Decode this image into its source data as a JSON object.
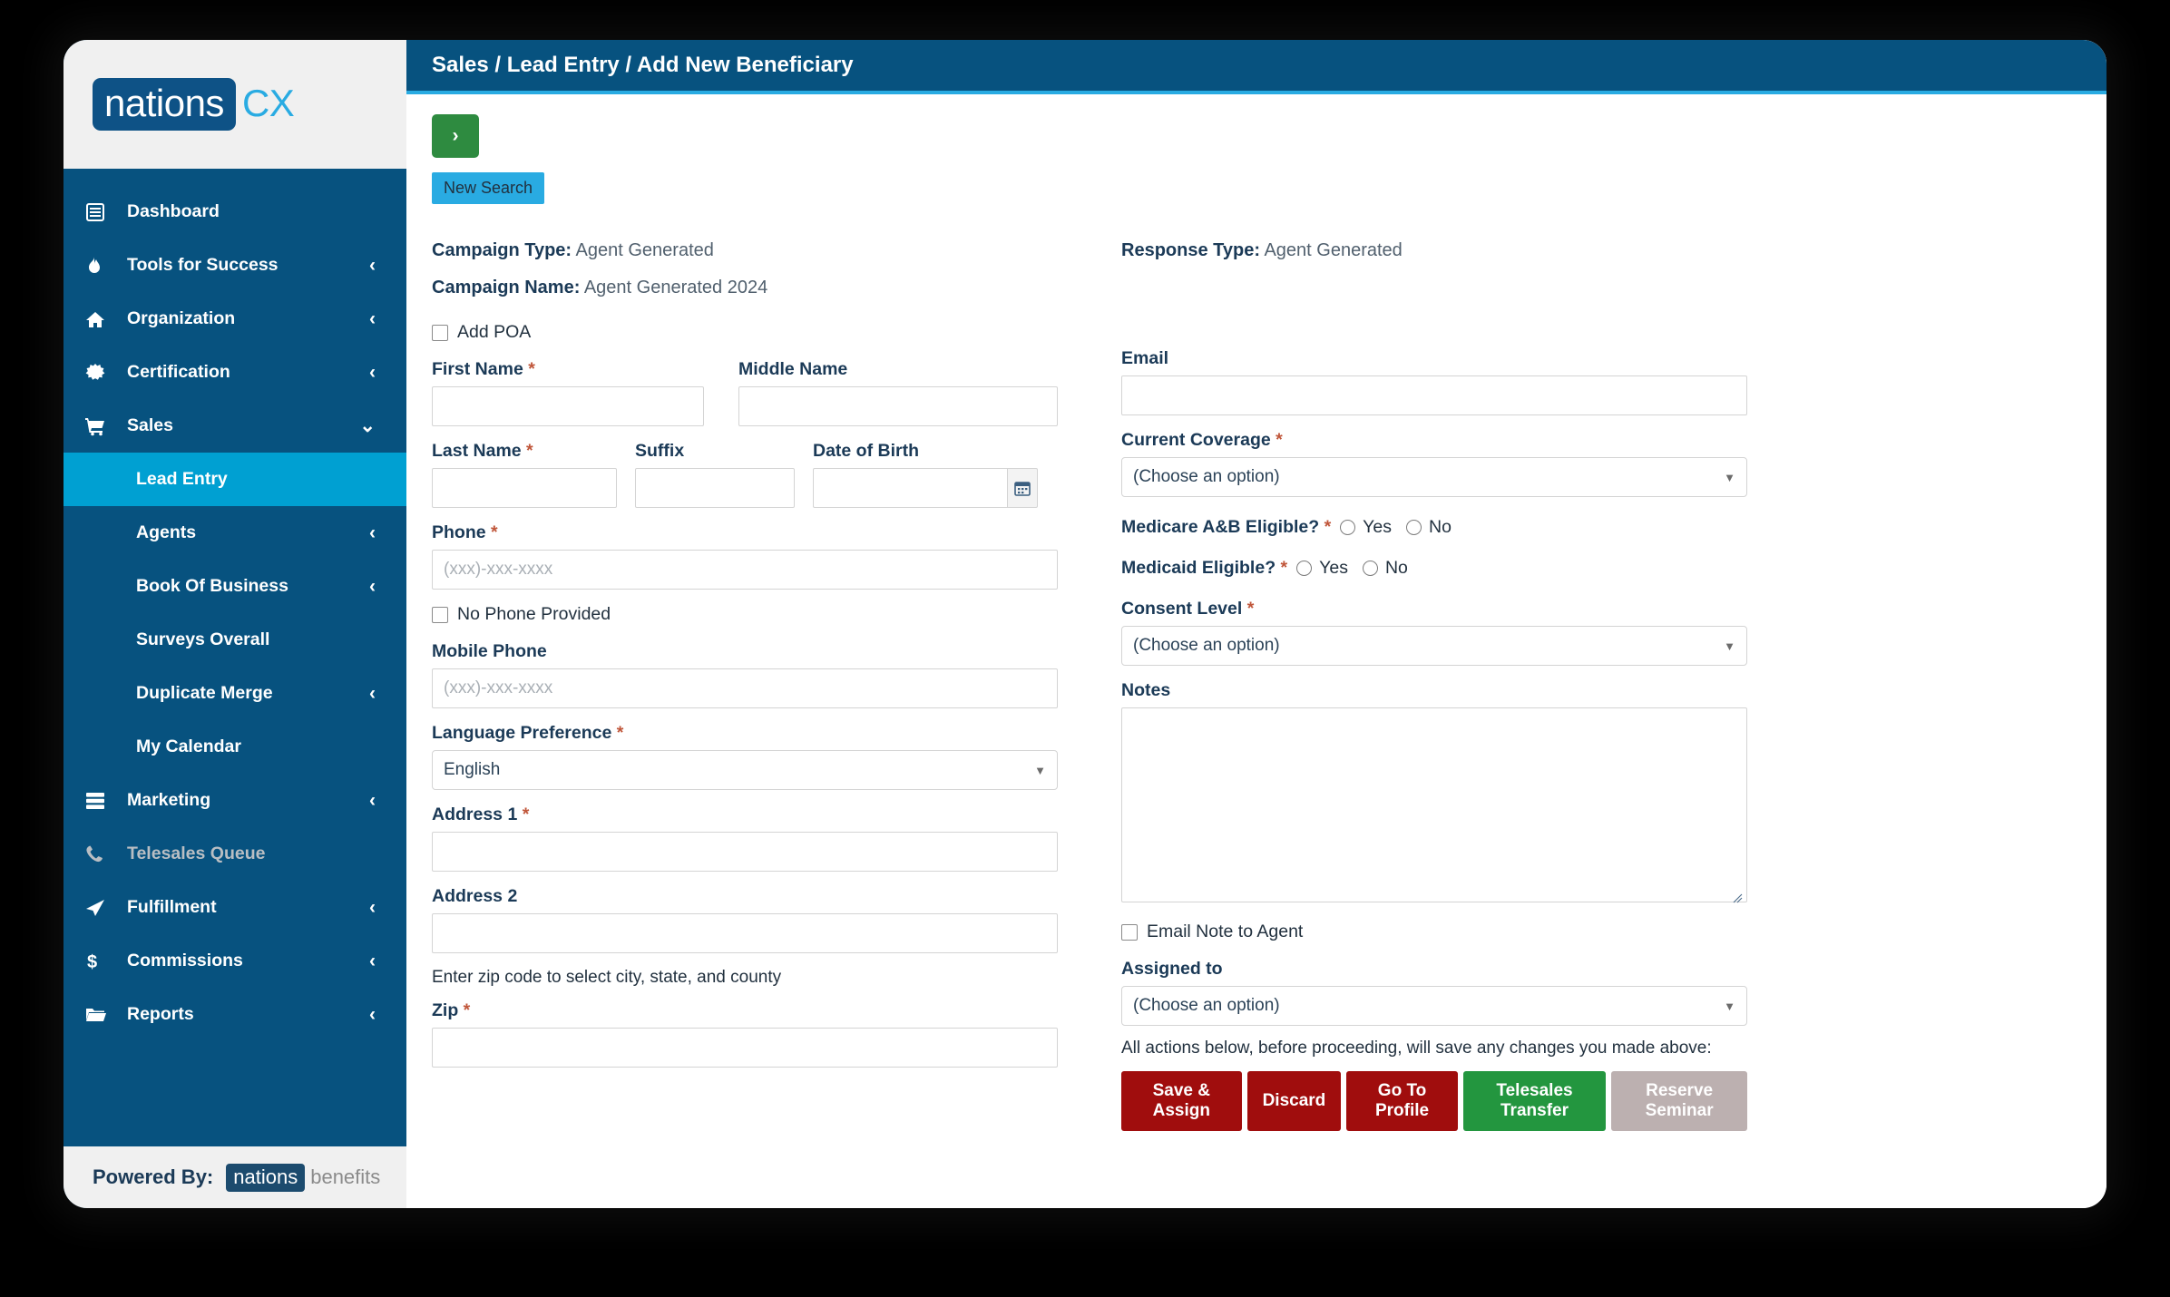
{
  "sidebar": {
    "logo": {
      "part1": "nations",
      "part2": "CX"
    },
    "items": [
      {
        "label": "Dashboard",
        "icon": "list-icon",
        "chevron": ""
      },
      {
        "label": "Tools for Success",
        "icon": "fire-icon",
        "chevron": "‹"
      },
      {
        "label": "Organization",
        "icon": "home-icon",
        "chevron": "‹"
      },
      {
        "label": "Certification",
        "icon": "certificate-icon",
        "chevron": "‹"
      },
      {
        "label": "Sales",
        "icon": "cart-icon",
        "chevron": "⌄"
      }
    ],
    "sub_items": [
      {
        "label": "Lead Entry",
        "chevron": "",
        "active": true
      },
      {
        "label": "Agents",
        "chevron": "‹",
        "active": false
      },
      {
        "label": "Book Of Business",
        "chevron": "‹",
        "active": false
      },
      {
        "label": "Surveys Overall",
        "chevron": "",
        "active": false
      },
      {
        "label": "Duplicate Merge",
        "chevron": "‹",
        "active": false
      },
      {
        "label": "My Calendar",
        "chevron": "",
        "active": false
      }
    ],
    "items_after": [
      {
        "label": "Marketing",
        "icon": "stack-icon",
        "chevron": "‹",
        "muted": false
      },
      {
        "label": "Telesales Queue",
        "icon": "phone-icon",
        "chevron": "",
        "muted": true
      },
      {
        "label": "Fulfillment",
        "icon": "send-icon",
        "chevron": "‹",
        "muted": false
      },
      {
        "label": "Commissions",
        "icon": "dollar-icon",
        "chevron": "‹",
        "muted": false
      },
      {
        "label": "Reports",
        "icon": "folder-icon",
        "chevron": "‹",
        "muted": false
      }
    ],
    "powered_by": {
      "label": "Powered By:",
      "brand1": "nations",
      "brand2": "benefits"
    }
  },
  "header": {
    "breadcrumb": "Sales / Lead Entry / Add New Beneficiary"
  },
  "toolbar": {
    "next_label": "›",
    "new_search_label": "New Search"
  },
  "meta": {
    "campaign_type_label": "Campaign Type:",
    "campaign_type_value": "Agent Generated",
    "campaign_name_label": "Campaign Name:",
    "campaign_name_value": "Agent Generated 2024",
    "response_type_label": "Response Type:",
    "response_type_value": "Agent Generated"
  },
  "form_left": {
    "add_poa_label": "Add POA",
    "first_name_label": "First Name",
    "first_name_value": "",
    "middle_name_label": "Middle Name",
    "middle_name_value": "",
    "last_name_label": "Last Name",
    "last_name_value": "",
    "suffix_label": "Suffix",
    "suffix_value": "",
    "dob_label": "Date of Birth",
    "dob_value": "",
    "phone_label": "Phone",
    "phone_placeholder": "(xxx)-xxx-xxxx",
    "phone_value": "",
    "no_phone_label": "No Phone Provided",
    "mobile_label": "Mobile Phone",
    "mobile_placeholder": "(xxx)-xxx-xxxx",
    "mobile_value": "",
    "language_label": "Language Preference",
    "language_value": "English",
    "address1_label": "Address 1",
    "address1_value": "",
    "address2_label": "Address 2",
    "address2_value": "",
    "zip_hint": "Enter zip code to select city, state, and county",
    "zip_label": "Zip",
    "zip_value": ""
  },
  "form_right": {
    "email_label": "Email",
    "email_value": "",
    "coverage_label": "Current Coverage",
    "coverage_value": "(Choose an option)",
    "medicare_label": "Medicare A&B Eligible?",
    "medicare_yes": "Yes",
    "medicare_no": "No",
    "medicaid_label": "Medicaid Eligible?",
    "medicaid_yes": "Yes",
    "medicaid_no": "No",
    "consent_label": "Consent Level",
    "consent_value": "(Choose an option)",
    "notes_label": "Notes",
    "notes_value": "",
    "email_note_label": "Email Note to Agent",
    "assigned_label": "Assigned to",
    "assigned_value": "(Choose an option)",
    "actions_notice": "All actions below, before proceeding, will save any changes you made above:",
    "buttons": [
      {
        "label": "Save & Assign",
        "style": "red"
      },
      {
        "label": "Discard",
        "style": "red"
      },
      {
        "label": "Go To Profile",
        "style": "red"
      },
      {
        "label": "Telesales Transfer",
        "style": "green"
      },
      {
        "label": "Reserve Seminar",
        "style": "gray"
      }
    ]
  },
  "colors": {
    "sidebar": "#07527F",
    "accent": "#29ABE2",
    "active": "#00A0D2",
    "danger": "#A00D0D",
    "success": "#23963F",
    "disabled": "#BCB0B0"
  }
}
